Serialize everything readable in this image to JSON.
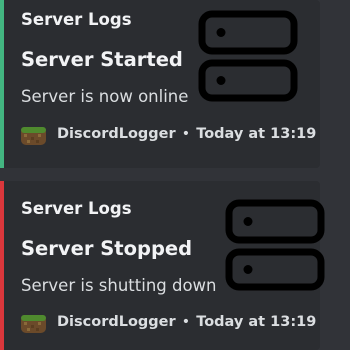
{
  "embeds": [
    {
      "author": "Server Logs",
      "title": "Server Started",
      "description": "Server is now online",
      "footer": {
        "avatar_icon": "grass-block-avatar-icon",
        "name": "DiscordLogger",
        "separator": "•",
        "time": "Today at 13:19"
      },
      "thumbnail_icon": "server-icon",
      "accent_color": "#43b581"
    },
    {
      "author": "Server Logs",
      "title": "Server Stopped",
      "description": "Server is shutting down",
      "footer": {
        "avatar_icon": "grass-block-avatar-icon",
        "name": "DiscordLogger",
        "separator": "•",
        "time": "Today at 13:19"
      },
      "thumbnail_icon": "server-icon",
      "accent_color": "#da373c"
    }
  ]
}
